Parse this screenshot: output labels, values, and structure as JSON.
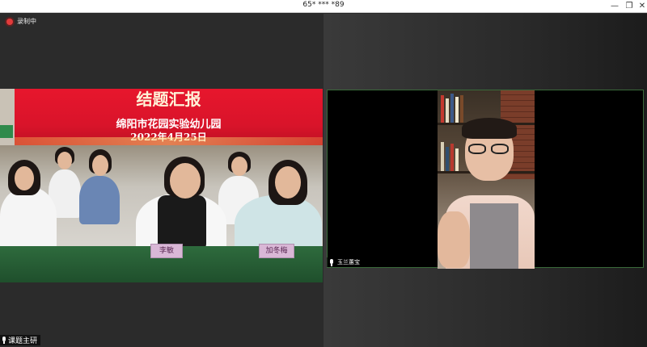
{
  "window": {
    "title": "65* *** *89",
    "minimize_glyph": "—",
    "maximize_glyph": "❐",
    "close_glyph": "✕"
  },
  "recording": {
    "label": "录制中",
    "color": "#e23b3b"
  },
  "left_video": {
    "banner_title": "结题汇报",
    "banner_subtitle": "绵阳市花园实验幼儿园",
    "banner_date": "2022年4月25日",
    "placards": [
      "李敏",
      "加冬梅"
    ],
    "banner_color": "#e7162d"
  },
  "right_video": {
    "participant_name": "玉兰蕙宝",
    "mic_icon": "microphone-icon",
    "border_color": "#3a6a3a"
  },
  "bottom_participant": {
    "name": "课题主研",
    "mic_icon": "microphone-icon"
  }
}
